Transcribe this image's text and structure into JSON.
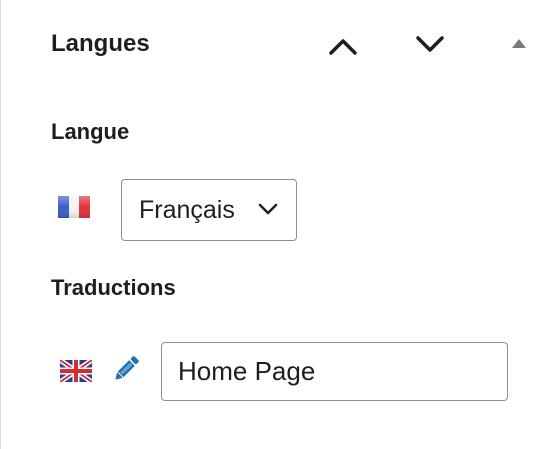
{
  "panel": {
    "title": "Langues",
    "controls": {
      "move_up_icon": "chevron-up-icon",
      "move_down_icon": "chevron-down-icon",
      "toggle_icon": "triangle-up-icon"
    }
  },
  "language": {
    "label": "Langue",
    "flag": "france-flag-icon",
    "selected": "Français"
  },
  "translations": {
    "label": "Traductions",
    "items": [
      {
        "flag": "united-kingdom-flag-icon",
        "edit_icon": "pencil-icon",
        "value": "Home Page"
      }
    ]
  },
  "colors": {
    "text": "#1e1e1e",
    "border": "#8c8f94",
    "link_blue": "#2271b1",
    "toggle_gray": "#787c82"
  }
}
